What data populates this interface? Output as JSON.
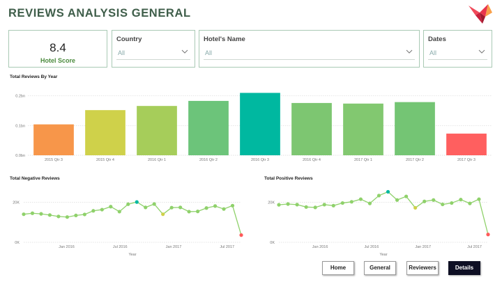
{
  "page": {
    "title": "REVIEWS ANALYSIS GENERAL"
  },
  "kpi": {
    "value": "8.4",
    "label": "Hotel Score"
  },
  "filters": [
    {
      "label": "Country",
      "value": "All"
    },
    {
      "label": "Hotel's Name",
      "value": "All"
    },
    {
      "label": "Dates",
      "value": "All"
    }
  ],
  "nav": {
    "buttons": [
      "Home",
      "General",
      "Reviewers",
      "Details"
    ],
    "active": "Details"
  },
  "colors": {
    "title": "#3f5e4a",
    "line": "#8fd16b",
    "accent": "#00b8a0",
    "low": "#ff5a5a"
  },
  "chart_data": [
    {
      "type": "bar",
      "title": "Total Reviews By Year",
      "categories": [
        "2015 Qtr 3",
        "2015 Qtr 4",
        "2016 Qtr 1",
        "2016 Qtr 2",
        "2016 Qtr 3",
        "2016 Qtr 4",
        "2017 Qtr 1",
        "2017 Qtr 2",
        "2017 Qtr 3"
      ],
      "values": [
        0.104,
        0.152,
        0.166,
        0.183,
        0.21,
        0.176,
        0.174,
        0.179,
        0.073
      ],
      "colors": [
        "#f7964a",
        "#cfd14a",
        "#a6cd5a",
        "#6cc47a",
        "#00b8a0",
        "#7dc671",
        "#82c870",
        "#74c574",
        "#ff5f5f"
      ],
      "yticks": [
        "0.0bn",
        "0.1bn",
        "0.2bn"
      ],
      "ylim": [
        0,
        0.225
      ],
      "grid": true
    },
    {
      "type": "line",
      "title": "Total Negative Reviews",
      "xlabel": "Year",
      "xticks": [
        "Jan 2016",
        "Jul 2016",
        "Jan 2017",
        "Jul 2017"
      ],
      "yticks": [
        "0K",
        "20K"
      ],
      "ylim": [
        0,
        25000
      ],
      "values": [
        14000,
        14500,
        14200,
        13600,
        12900,
        12600,
        13400,
        13900,
        15700,
        16300,
        17800,
        15300,
        19000,
        20100,
        17400,
        19100,
        14000,
        17300,
        17400,
        15300,
        15400,
        17100,
        18100,
        16600,
        18300,
        3600
      ],
      "point_colors": [
        "#8fd16b",
        "#8fd16b",
        "#8fd16b",
        "#8fd16b",
        "#8fd16b",
        "#8fd16b",
        "#8fd16b",
        "#8fd16b",
        "#8fd16b",
        "#8fd16b",
        "#8fd16b",
        "#8fd16b",
        "#8fd16b",
        "#00b8a0",
        "#8fd16b",
        "#8fd16b",
        "#cfd14a",
        "#8fd16b",
        "#8fd16b",
        "#8fd16b",
        "#8fd16b",
        "#8fd16b",
        "#8fd16b",
        "#8fd16b",
        "#8fd16b",
        "#ff5a5a"
      ]
    },
    {
      "type": "line",
      "title": "Total Positive Reviews",
      "xlabel": "Year",
      "xticks": [
        "Jan 2016",
        "Jul 2016",
        "Jan 2017",
        "Jul 2017"
      ],
      "yticks": [
        "0K",
        "20K"
      ],
      "ylim": [
        0,
        25000
      ],
      "values": [
        18700,
        19100,
        18800,
        17600,
        17400,
        18800,
        18300,
        19600,
        20200,
        21500,
        19400,
        23300,
        25200,
        21100,
        22900,
        17200,
        20400,
        21100,
        18900,
        19600,
        21300,
        19400,
        21500,
        3900
      ],
      "point_colors": [
        "#8fd16b",
        "#8fd16b",
        "#8fd16b",
        "#8fd16b",
        "#8fd16b",
        "#8fd16b",
        "#8fd16b",
        "#8fd16b",
        "#8fd16b",
        "#8fd16b",
        "#8fd16b",
        "#8fd16b",
        "#00b8a0",
        "#8fd16b",
        "#8fd16b",
        "#cfd14a",
        "#8fd16b",
        "#8fd16b",
        "#8fd16b",
        "#8fd16b",
        "#8fd16b",
        "#8fd16b",
        "#8fd16b",
        "#ff5a5a"
      ]
    }
  ]
}
